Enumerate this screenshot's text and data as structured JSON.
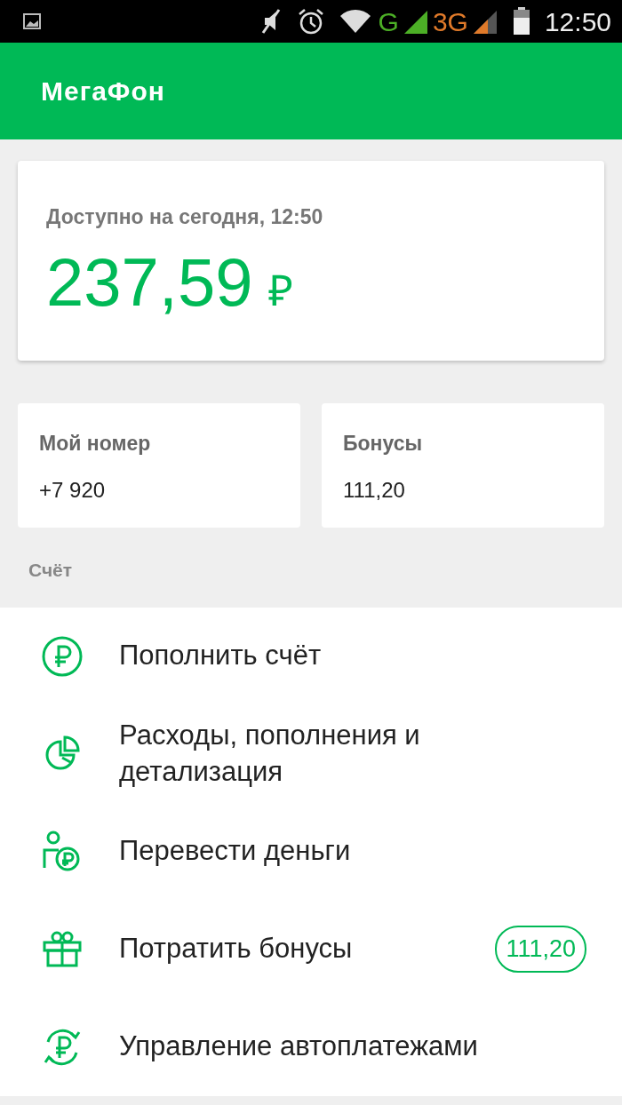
{
  "status_bar": {
    "network_1": "G",
    "network_2": "3G",
    "time": "12:50"
  },
  "app_bar": {
    "logo": "МегаФон"
  },
  "balance": {
    "label": "Доступно на сегодня, 12:50",
    "amount": "237,59",
    "currency": "₽"
  },
  "tiles": [
    {
      "label": "Мой номер",
      "value": "+7 920"
    },
    {
      "label": "Бонусы",
      "value": "111,20"
    }
  ],
  "section_title": "Счёт",
  "menu": [
    {
      "label": "Пополнить счёт"
    },
    {
      "label": "Расходы, пополнения и детализация"
    },
    {
      "label": "Перевести деньги"
    },
    {
      "label": "Потратить бонусы",
      "badge": "111,20"
    },
    {
      "label": "Управление автоплатежами"
    }
  ]
}
